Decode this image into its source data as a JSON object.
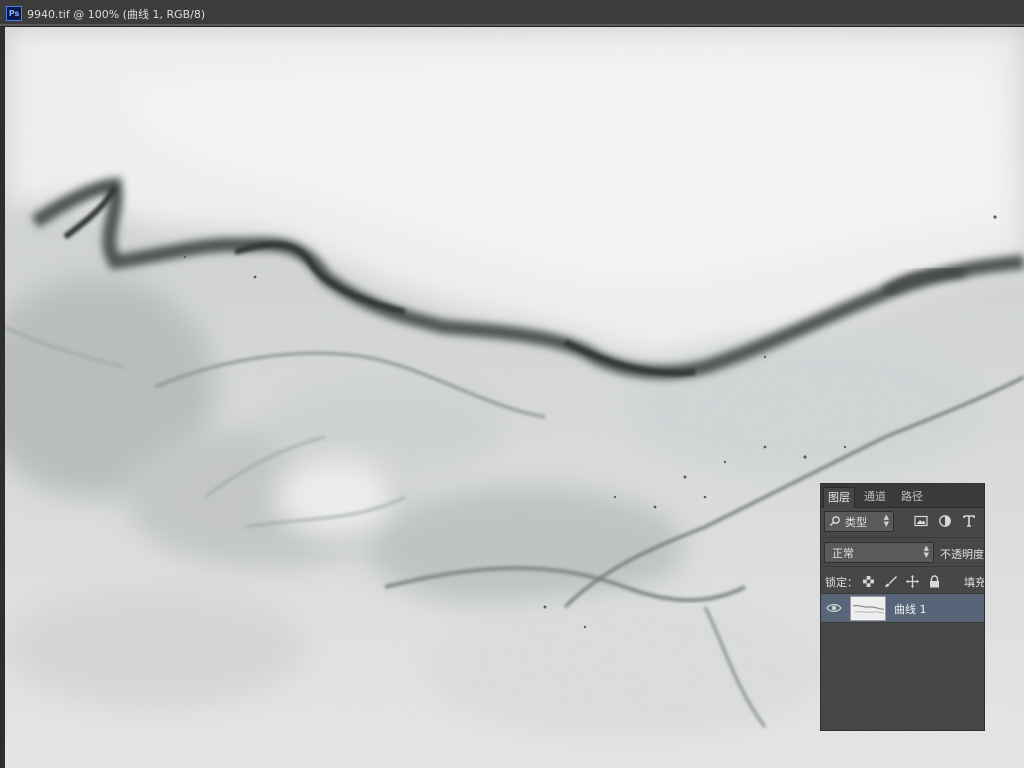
{
  "document": {
    "app_icon": "Ps",
    "title": "9940.tif @ 100% (曲线 1, RGB/8)"
  },
  "layers_panel": {
    "tabs": [
      {
        "label": "图层",
        "active": true
      },
      {
        "label": "通道",
        "active": false
      },
      {
        "label": "路径",
        "active": false
      }
    ],
    "filter": {
      "kind_label": "类型",
      "icons": [
        "image-filter-icon",
        "adjustment-filter-icon",
        "type-filter-icon"
      ]
    },
    "blend_mode": "正常",
    "opacity_label": "不透明度",
    "lock_label": "锁定：",
    "lock_icons": [
      "lock-transparent-icon",
      "lock-brush-icon",
      "lock-move-icon",
      "lock-all-icon"
    ],
    "fill_label": "填充",
    "layers": [
      {
        "name": "曲线 1",
        "visible": true,
        "selected": true
      }
    ]
  },
  "colors": {
    "panel_bg": "#474747",
    "selected_layer": "#586579",
    "marble_base": "#d9dbdb"
  }
}
